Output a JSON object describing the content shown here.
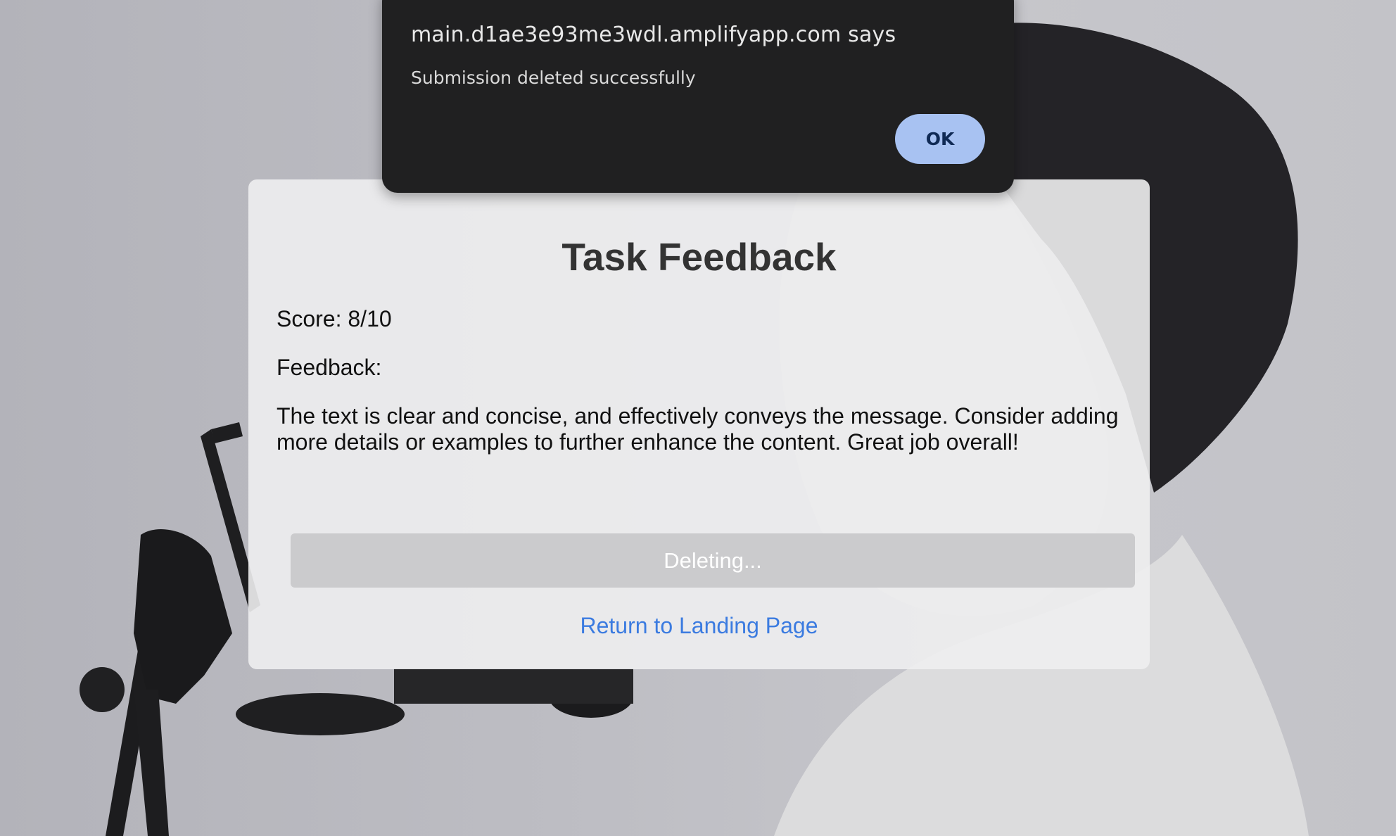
{
  "alert": {
    "title": "main.d1ae3e93me3wdl.amplifyapp.com says",
    "message": "Submission deleted successfully",
    "ok_label": "OK"
  },
  "card": {
    "title": "Task Feedback",
    "score": "Score: 8/10",
    "feedback_label": "Feedback:",
    "feedback_text": "The text is clear and concise, and effectively conveys the message. Consider adding more details or examples to further enhance the content. Great job overall!",
    "delete_button_label": "Deleting...",
    "return_link_label": "Return to Landing Page"
  },
  "colors": {
    "dialog_bg": "#202021",
    "ok_button_bg": "#a8c2f2",
    "link": "#3b7be0",
    "disabled_button": "#cbcbcd"
  }
}
